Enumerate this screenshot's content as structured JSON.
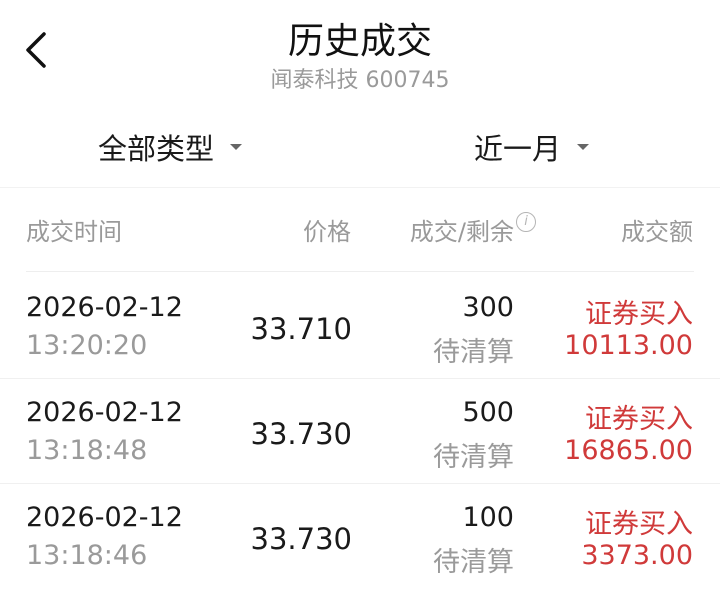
{
  "header": {
    "title": "历史成交",
    "subtitle": "闻泰科技 600745"
  },
  "filters": {
    "type_label": "全部类型",
    "period_label": "近一月"
  },
  "columns": {
    "time": "成交时间",
    "price": "价格",
    "qty_remaining": "成交/剩余",
    "info_icon": "i",
    "amount": "成交额"
  },
  "rows": [
    {
      "date": "2026-02-12",
      "time": "13:20:20",
      "price": "33.710",
      "qty": "300",
      "status": "待清算",
      "type": "证券买入",
      "amount": "10113.00"
    },
    {
      "date": "2026-02-12",
      "time": "13:18:48",
      "price": "33.730",
      "qty": "500",
      "status": "待清算",
      "type": "证券买入",
      "amount": "16865.00"
    },
    {
      "date": "2026-02-12",
      "time": "13:18:46",
      "price": "33.730",
      "qty": "100",
      "status": "待清算",
      "type": "证券买入",
      "amount": "3373.00"
    }
  ],
  "colors": {
    "buy_red": "#d03a3a",
    "muted_gray": "#9a9a9a"
  },
  "icons": {
    "back": "chevron-left-icon",
    "dropdown": "caret-down-icon",
    "info": "info-circle-icon"
  }
}
